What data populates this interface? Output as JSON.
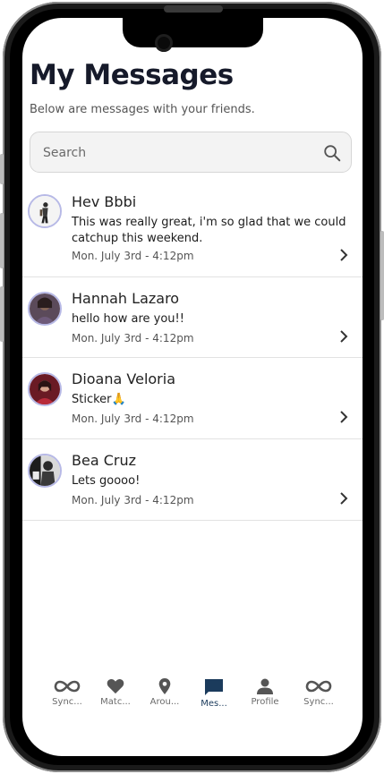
{
  "page": {
    "title": "My Messages",
    "subtitle": "Below are messages with your friends."
  },
  "search": {
    "placeholder": "Search",
    "icon": "search-icon"
  },
  "conversations": [
    {
      "name": "Hev Bbbi",
      "message": "This was really great, i'm so glad that we could catchup this weekend.",
      "timestamp": "Mon. July 3rd - 4:12pm"
    },
    {
      "name": "Hannah Lazaro",
      "message": "hello how are you!!",
      "timestamp": "Mon. July 3rd - 4:12pm"
    },
    {
      "name": "Dioana Veloria",
      "message": "Sticker🙏",
      "timestamp": "Mon. July 3rd - 4:12pm"
    },
    {
      "name": "Bea Cruz",
      "message": "Lets goooo!",
      "timestamp": "Mon. July 3rd - 4:12pm"
    }
  ],
  "tabbar": {
    "active_tab": "Mes...",
    "active_color": "#1b3b5c",
    "inactive_color": "#555555",
    "tabs": [
      {
        "label": "Sync...",
        "icon": "infinity-icon"
      },
      {
        "label": "Matc...",
        "icon": "heart-icon"
      },
      {
        "label": "Arou...",
        "icon": "location-pin-icon"
      },
      {
        "label": "Mes...",
        "icon": "chat-bubble-icon"
      },
      {
        "label": "Profile",
        "icon": "person-icon"
      },
      {
        "label": "Sync...",
        "icon": "infinity-icon"
      }
    ]
  }
}
